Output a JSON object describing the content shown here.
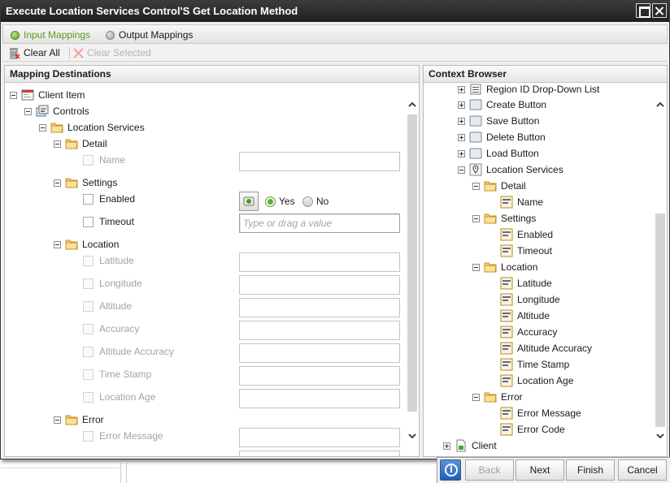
{
  "window": {
    "title": "Execute Location Services Control'S Get Location Method"
  },
  "tabs": [
    {
      "label": "Input Mappings",
      "active": true
    },
    {
      "label": "Output Mappings",
      "active": false
    }
  ],
  "toolbar": {
    "clear_all": "Clear All",
    "clear_selected": "Clear Selected"
  },
  "mapping": {
    "title": "Mapping Destinations",
    "tree": {
      "client_item": "Client Item",
      "controls": "Controls",
      "location_services": "Location Services",
      "detail": "Detail",
      "settings": "Settings",
      "location": "Location",
      "error": "Error"
    },
    "fields": {
      "name": "Name",
      "enabled": "Enabled",
      "timeout": "Timeout",
      "timeout_placeholder": "Type or drag a value",
      "latitude": "Latitude",
      "longitude": "Longitude",
      "altitude": "Altitude",
      "accuracy": "Accuracy",
      "altitude_accuracy": "Altitude Accuracy",
      "time_stamp": "Time Stamp",
      "location_age": "Location Age",
      "error_message": "Error Message"
    },
    "enabled_options": {
      "yes": "Yes",
      "no": "No",
      "selected": "Yes"
    }
  },
  "context": {
    "title": "Context Browser",
    "items": {
      "region": "Region ID Drop-Down List",
      "create_button": "Create Button",
      "save_button": "Save Button",
      "delete_button": "Delete Button",
      "load_button": "Load Button",
      "location_services": "Location Services",
      "detail": "Detail",
      "name": "Name",
      "settings": "Settings",
      "enabled": "Enabled",
      "timeout": "Timeout",
      "location": "Location",
      "latitude": "Latitude",
      "longitude": "Longitude",
      "altitude": "Altitude",
      "accuracy": "Accuracy",
      "altitude_accuracy": "Altitude Accuracy",
      "time_stamp": "Time Stamp",
      "location_age": "Location Age",
      "error": "Error",
      "error_message": "Error Message",
      "error_code": "Error Code",
      "client": "Client"
    }
  },
  "footer": {
    "back": "Back",
    "next": "Next",
    "finish": "Finish",
    "cancel": "Cancel"
  },
  "icons": {
    "folder": "folder-icon",
    "property": "property-icon",
    "control": "button-control-icon",
    "location_pin": "location-pin-icon",
    "info": "info-icon"
  }
}
